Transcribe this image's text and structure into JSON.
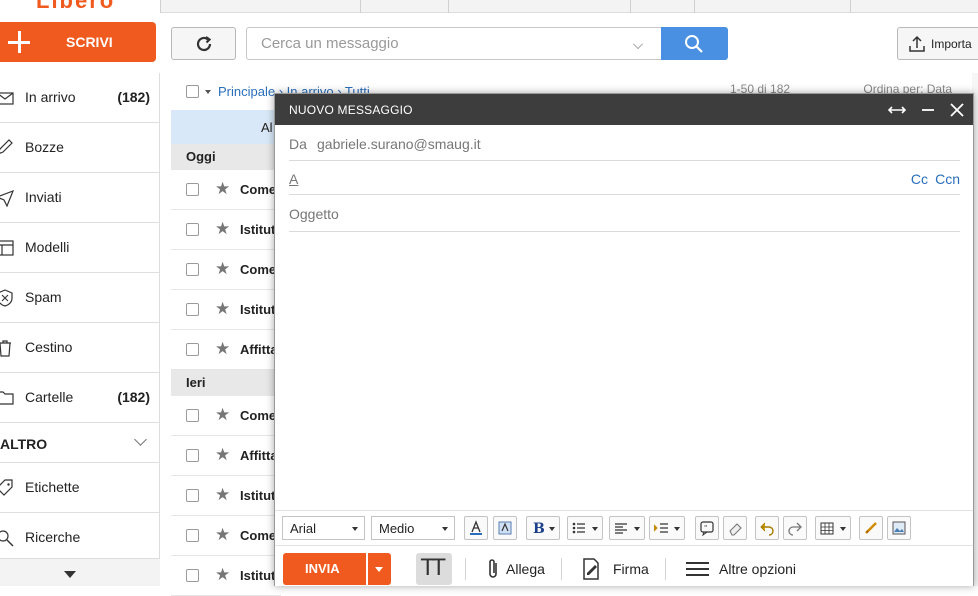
{
  "toolbar": {
    "compose_label": "SCRIVI",
    "search_placeholder": "Cerca un messaggio",
    "import_label": "Importa"
  },
  "sidebar": {
    "items": [
      {
        "label": "In arrivo",
        "count": "(182)"
      },
      {
        "label": "Bozze",
        "count": ""
      },
      {
        "label": "Inviati",
        "count": ""
      },
      {
        "label": "Modelli",
        "count": ""
      },
      {
        "label": "Spam",
        "count": ""
      },
      {
        "label": "Cestino",
        "count": ""
      },
      {
        "label": "Cartelle",
        "count": "(182)"
      }
    ],
    "section_label": "ALTRO",
    "extra_items": [
      {
        "label": "Etichette"
      },
      {
        "label": "Ricerche"
      }
    ]
  },
  "mail_list": {
    "breadcrumb": "Principale › In arrivo › Tutti",
    "pagination": "1-50 di 182",
    "sort_label": "Ordina per: Data",
    "select_all_label": "Al",
    "groups": [
      {
        "label": "Oggi",
        "rows": [
          "Come",
          "Istitut",
          "Come",
          "Istitut",
          "Affitta"
        ]
      },
      {
        "label": "Ieri",
        "rows": [
          "Come",
          "Affitta",
          "Istitut",
          "Come",
          "Istitut"
        ]
      }
    ]
  },
  "compose": {
    "title": "NUOVO MESSAGGIO",
    "from_label": "Da",
    "from_value": "gabriele.surano@smaug.it",
    "to_label": "A",
    "cc_label": "Cc",
    "bcc_label": "Ccn",
    "subject_placeholder": "Oggetto",
    "font_family": "Arial",
    "font_size": "Medio",
    "send_label": "INVIA",
    "attach_label": "Allega",
    "signature_label": "Firma",
    "more_label": "Altre opzioni"
  },
  "colors": {
    "brand": "#f05a1e",
    "accent": "#4a90e2",
    "link": "#2a6ebb",
    "modal_header": "#3d3d3d"
  }
}
